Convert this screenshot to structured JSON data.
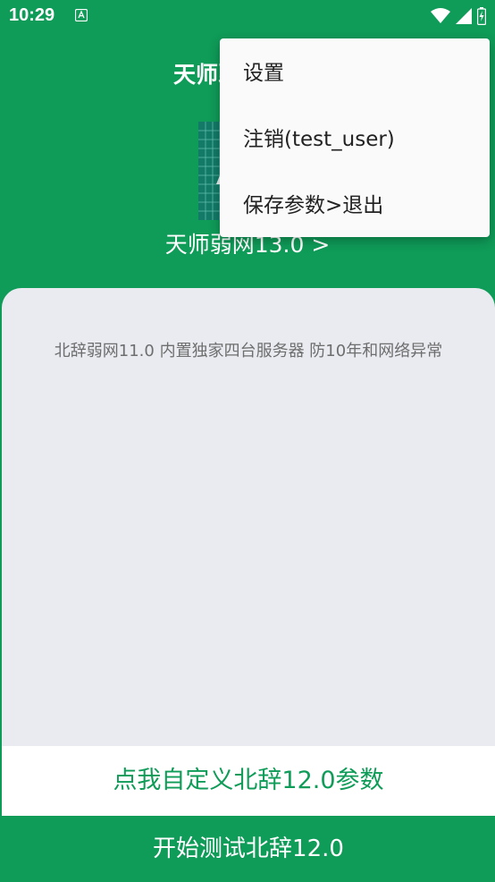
{
  "status_bar": {
    "time": "10:29",
    "icons": [
      "app-notification-icon",
      "wifi-icon",
      "cell-signal-icon",
      "battery-charging-icon"
    ]
  },
  "header": {
    "title": "天师弱网"
  },
  "version": {
    "label": "天师弱网13.0 >"
  },
  "main": {
    "description": "北辞弱网11.0 内置独家四台服务器 防10年和网络异常"
  },
  "buttons": {
    "custom_label": "点我自定义北辞12.0参数",
    "start_label": "开始测试北辞12.0"
  },
  "menu": {
    "items": [
      {
        "label": "设置"
      },
      {
        "label": "注销(test_user)"
      },
      {
        "label": "保存参数>退出"
      }
    ]
  },
  "colors": {
    "brand_green": "#0f9b58",
    "card_bg": "#e9ebf0",
    "menu_bg": "#fafafa",
    "text_gray": "#6e6e6e"
  }
}
